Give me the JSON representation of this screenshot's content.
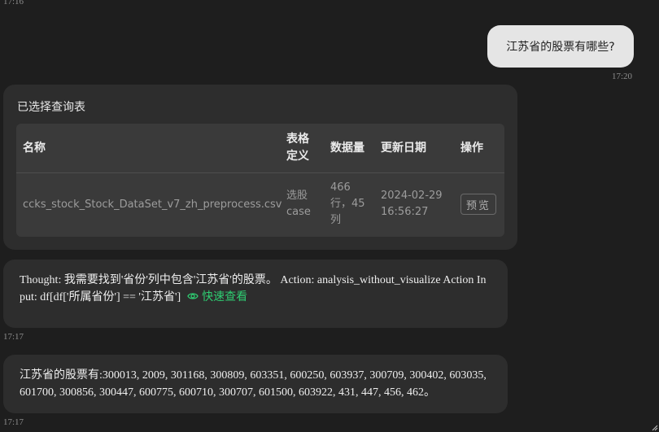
{
  "timestamps": {
    "top": "17:16",
    "user": "17:20",
    "thought": "17:17",
    "answer": "17:17"
  },
  "user_message": "江苏省的股票有哪些?",
  "table_card": {
    "title": "已选择查询表",
    "columns": {
      "name": "名称",
      "definition_line1": "表格",
      "definition_line2": "定义",
      "count": "数据量",
      "date": "更新日期",
      "actions": "操作"
    },
    "rows": [
      {
        "name": "ccks_stock_Stock_DataSet_v7_zh_preprocess.csv",
        "definition_line1": "选股",
        "definition_line2": "case",
        "count_line1": "466",
        "count_line2": "行，45",
        "count_line3": "列",
        "date_line1": "2024-02-29",
        "date_line2": "16:56:27",
        "preview_label": "预览"
      }
    ]
  },
  "thought_message": {
    "line1": "Thought: 我需要找到'省份'列中包含'江苏省'的股票。 Action: analysis_without_visualize Action In",
    "line2": "put: df[df['所属省份'] == '江苏省']",
    "quick_view_label": "快速查看"
  },
  "answer_message": {
    "line1": "江苏省的股票有:300013, 2009, 301168, 300809, 603351, 600250, 603937, 300709, 300402, 603035,",
    "line2": "601700, 300856, 300447, 600775, 600710, 300707, 601500, 603922, 431, 447, 456, 462。"
  },
  "colors": {
    "background": "#1e1e1e",
    "bubble": "#2d2d2d",
    "user_bubble": "#e5e5e5",
    "accent": "#2ecc71"
  }
}
